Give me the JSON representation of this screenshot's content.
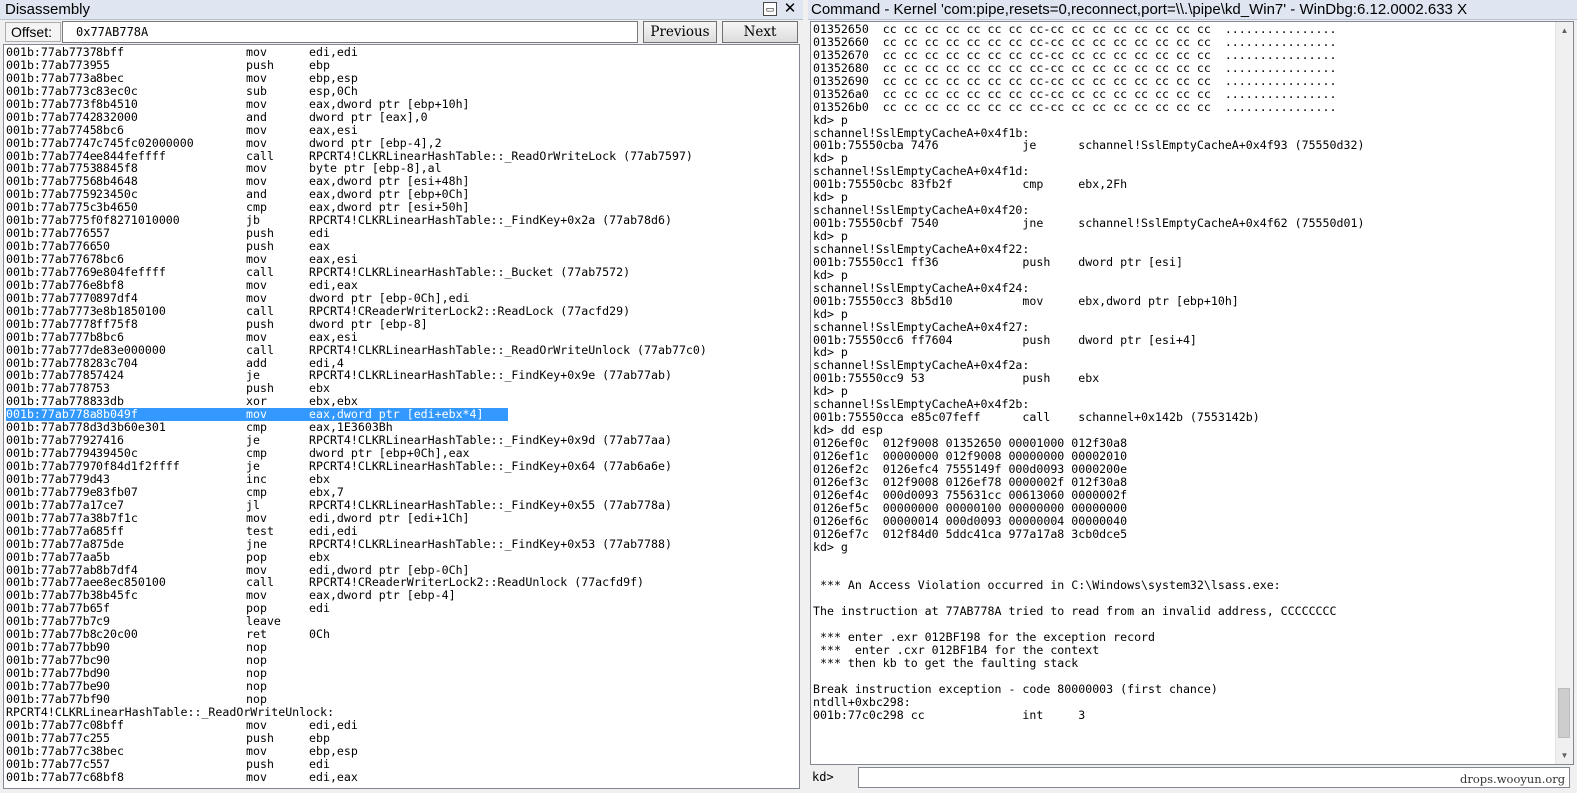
{
  "disassembly": {
    "title": "Disassembly",
    "restore_glyph": "▭",
    "close_glyph": "✕",
    "offset_label": "Offset:",
    "offset_value": "0x77AB778A",
    "previous_label": "Previous",
    "next_label": "Next",
    "lines": [
      {
        "addr": "001b:77ab7737",
        "bytes": "8bff",
        "mn": "mov",
        "op": "edi,edi"
      },
      {
        "addr": "001b:77ab7739",
        "bytes": "55",
        "mn": "push",
        "op": "ebp"
      },
      {
        "addr": "001b:77ab773a",
        "bytes": "8bec",
        "mn": "mov",
        "op": "ebp,esp"
      },
      {
        "addr": "001b:77ab773c",
        "bytes": "83ec0c",
        "mn": "sub",
        "op": "esp,0Ch"
      },
      {
        "addr": "001b:77ab773f",
        "bytes": "8b4510",
        "mn": "mov",
        "op": "eax,dword ptr [ebp+10h]"
      },
      {
        "addr": "001b:77ab7742",
        "bytes": "832000",
        "mn": "and",
        "op": "dword ptr [eax],0"
      },
      {
        "addr": "001b:77ab7745",
        "bytes": "8bc6",
        "mn": "mov",
        "op": "eax,esi"
      },
      {
        "addr": "001b:77ab7747",
        "bytes": "c745fc02000000",
        "mn": "mov",
        "op": "dword ptr [ebp-4],2"
      },
      {
        "addr": "001b:77ab774e",
        "bytes": "e844feffff",
        "mn": "call",
        "op": "RPCRT4!CLKRLinearHashTable::_ReadOrWriteLock (77ab7597)"
      },
      {
        "addr": "001b:77ab7753",
        "bytes": "8845f8",
        "mn": "mov",
        "op": "byte ptr [ebp-8],al"
      },
      {
        "addr": "001b:77ab7756",
        "bytes": "8b4648",
        "mn": "mov",
        "op": "eax,dword ptr [esi+48h]"
      },
      {
        "addr": "001b:77ab7759",
        "bytes": "23450c",
        "mn": "and",
        "op": "eax,dword ptr [ebp+0Ch]"
      },
      {
        "addr": "001b:77ab775c",
        "bytes": "3b4650",
        "mn": "cmp",
        "op": "eax,dword ptr [esi+50h]"
      },
      {
        "addr": "001b:77ab775f",
        "bytes": "0f8271010000",
        "mn": "jb",
        "op": "RPCRT4!CLKRLinearHashTable::_FindKey+0x2a (77ab78d6)"
      },
      {
        "addr": "001b:77ab7765",
        "bytes": "57",
        "mn": "push",
        "op": "edi"
      },
      {
        "addr": "001b:77ab7766",
        "bytes": "50",
        "mn": "push",
        "op": "eax"
      },
      {
        "addr": "001b:77ab7767",
        "bytes": "8bc6",
        "mn": "mov",
        "op": "eax,esi"
      },
      {
        "addr": "001b:77ab7769",
        "bytes": "e804feffff",
        "mn": "call",
        "op": "RPCRT4!CLKRLinearHashTable::_Bucket (77ab7572)"
      },
      {
        "addr": "001b:77ab776e",
        "bytes": "8bf8",
        "mn": "mov",
        "op": "edi,eax"
      },
      {
        "addr": "001b:77ab7770",
        "bytes": "897df4",
        "mn": "mov",
        "op": "dword ptr [ebp-0Ch],edi"
      },
      {
        "addr": "001b:77ab7773",
        "bytes": "e8b1850100",
        "mn": "call",
        "op": "RPCRT4!CReaderWriterLock2::ReadLock (77acfd29)"
      },
      {
        "addr": "001b:77ab7778",
        "bytes": "ff75f8",
        "mn": "push",
        "op": "dword ptr [ebp-8]"
      },
      {
        "addr": "001b:77ab777b",
        "bytes": "8bc6",
        "mn": "mov",
        "op": "eax,esi"
      },
      {
        "addr": "001b:77ab777d",
        "bytes": "e83e000000",
        "mn": "call",
        "op": "RPCRT4!CLKRLinearHashTable::_ReadOrWriteUnlock (77ab77c0)"
      },
      {
        "addr": "001b:77ab7782",
        "bytes": "83c704",
        "mn": "add",
        "op": "edi,4"
      },
      {
        "addr": "001b:77ab7785",
        "bytes": "7424",
        "mn": "je",
        "op": "RPCRT4!CLKRLinearHashTable::_FindKey+0x9e (77ab77ab)"
      },
      {
        "addr": "001b:77ab7787",
        "bytes": "53",
        "mn": "push",
        "op": "ebx"
      },
      {
        "addr": "001b:77ab7788",
        "bytes": "33db",
        "mn": "xor",
        "op": "ebx,ebx"
      },
      {
        "addr": "001b:77ab778a",
        "bytes": "8b049f",
        "mn": "mov",
        "op": "eax,dword ptr [edi+ebx*4]",
        "selected": true
      },
      {
        "addr": "001b:77ab778d",
        "bytes": "3d3b60e301",
        "mn": "cmp",
        "op": "eax,1E3603Bh"
      },
      {
        "addr": "001b:77ab7792",
        "bytes": "7416",
        "mn": "je",
        "op": "RPCRT4!CLKRLinearHashTable::_FindKey+0x9d (77ab77aa)"
      },
      {
        "addr": "001b:77ab7794",
        "bytes": "39450c",
        "mn": "cmp",
        "op": "dword ptr [ebp+0Ch],eax"
      },
      {
        "addr": "001b:77ab7797",
        "bytes": "0f84d1f2ffff",
        "mn": "je",
        "op": "RPCRT4!CLKRLinearHashTable::_FindKey+0x64 (77ab6a6e)"
      },
      {
        "addr": "001b:77ab779d",
        "bytes": "43",
        "mn": "inc",
        "op": "ebx"
      },
      {
        "addr": "001b:77ab779e",
        "bytes": "83fb07",
        "mn": "cmp",
        "op": "ebx,7"
      },
      {
        "addr": "001b:77ab77a1",
        "bytes": "7ce7",
        "mn": "jl",
        "op": "RPCRT4!CLKRLinearHashTable::_FindKey+0x55 (77ab778a)"
      },
      {
        "addr": "001b:77ab77a3",
        "bytes": "8b7f1c",
        "mn": "mov",
        "op": "edi,dword ptr [edi+1Ch]"
      },
      {
        "addr": "001b:77ab77a6",
        "bytes": "85ff",
        "mn": "test",
        "op": "edi,edi"
      },
      {
        "addr": "001b:77ab77a8",
        "bytes": "75de",
        "mn": "jne",
        "op": "RPCRT4!CLKRLinearHashTable::_FindKey+0x53 (77ab7788)"
      },
      {
        "addr": "001b:77ab77aa",
        "bytes": "5b",
        "mn": "pop",
        "op": "ebx"
      },
      {
        "addr": "001b:77ab77ab",
        "bytes": "8b7df4",
        "mn": "mov",
        "op": "edi,dword ptr [ebp-0Ch]"
      },
      {
        "addr": "001b:77ab77ae",
        "bytes": "e8ec850100",
        "mn": "call",
        "op": "RPCRT4!CReaderWriterLock2::ReadUnlock (77acfd9f)"
      },
      {
        "addr": "001b:77ab77b3",
        "bytes": "8b45fc",
        "mn": "mov",
        "op": "eax,dword ptr [ebp-4]"
      },
      {
        "addr": "001b:77ab77b6",
        "bytes": "5f",
        "mn": "pop",
        "op": "edi"
      },
      {
        "addr": "001b:77ab77b7",
        "bytes": "c9",
        "mn": "leave",
        "op": ""
      },
      {
        "addr": "001b:77ab77b8",
        "bytes": "c20c00",
        "mn": "ret",
        "op": "0Ch"
      },
      {
        "addr": "001b:77ab77bb",
        "bytes": "90",
        "mn": "nop",
        "op": ""
      },
      {
        "addr": "001b:77ab77bc",
        "bytes": "90",
        "mn": "nop",
        "op": ""
      },
      {
        "addr": "001b:77ab77bd",
        "bytes": "90",
        "mn": "nop",
        "op": ""
      },
      {
        "addr": "001b:77ab77be",
        "bytes": "90",
        "mn": "nop",
        "op": ""
      },
      {
        "addr": "001b:77ab77bf",
        "bytes": "90",
        "mn": "nop",
        "op": ""
      },
      {
        "label": "RPCRT4!CLKRLinearHashTable::_ReadOrWriteUnlock:"
      },
      {
        "addr": "001b:77ab77c0",
        "bytes": "8bff",
        "mn": "mov",
        "op": "edi,edi"
      },
      {
        "addr": "001b:77ab77c2",
        "bytes": "55",
        "mn": "push",
        "op": "ebp"
      },
      {
        "addr": "001b:77ab77c3",
        "bytes": "8bec",
        "mn": "mov",
        "op": "ebp,esp"
      },
      {
        "addr": "001b:77ab77c5",
        "bytes": "57",
        "mn": "push",
        "op": "edi"
      },
      {
        "addr": "001b:77ab77c6",
        "bytes": "8bf8",
        "mn": "mov",
        "op": "edi,eax"
      }
    ]
  },
  "command": {
    "title": "Command - Kernel 'com:pipe,resets=0,reconnect,port=\\\\.\\pipe\\kd_Win7' - WinDbg:6.12.0002.633 X",
    "prompt_label": "kd>",
    "input_value": "",
    "scroll_up_glyph": "▲",
    "scroll_down_glyph": "▼",
    "lines": [
      "01352650  cc cc cc cc cc cc cc cc-cc cc cc cc cc cc cc cc  ................",
      "01352660  cc cc cc cc cc cc cc cc-cc cc cc cc cc cc cc cc  ................",
      "01352670  cc cc cc cc cc cc cc cc-cc cc cc cc cc cc cc cc  ................",
      "01352680  cc cc cc cc cc cc cc cc-cc cc cc cc cc cc cc cc  ................",
      "01352690  cc cc cc cc cc cc cc cc-cc cc cc cc cc cc cc cc  ................",
      "013526a0  cc cc cc cc cc cc cc cc-cc cc cc cc cc cc cc cc  ................",
      "013526b0  cc cc cc cc cc cc cc cc-cc cc cc cc cc cc cc cc  ................",
      "kd> p",
      "schannel!SslEmptyCacheA+0x4f1b:",
      "001b:75550cba 7476            je      schannel!SslEmptyCacheA+0x4f93 (75550d32)",
      "kd> p",
      "schannel!SslEmptyCacheA+0x4f1d:",
      "001b:75550cbc 83fb2f          cmp     ebx,2Fh",
      "kd> p",
      "schannel!SslEmptyCacheA+0x4f20:",
      "001b:75550cbf 7540            jne     schannel!SslEmptyCacheA+0x4f62 (75550d01)",
      "kd> p",
      "schannel!SslEmptyCacheA+0x4f22:",
      "001b:75550cc1 ff36            push    dword ptr [esi]",
      "kd> p",
      "schannel!SslEmptyCacheA+0x4f24:",
      "001b:75550cc3 8b5d10          mov     ebx,dword ptr [ebp+10h]",
      "kd> p",
      "schannel!SslEmptyCacheA+0x4f27:",
      "001b:75550cc6 ff7604          push    dword ptr [esi+4]",
      "kd> p",
      "schannel!SslEmptyCacheA+0x4f2a:",
      "001b:75550cc9 53              push    ebx",
      "kd> p",
      "schannel!SslEmptyCacheA+0x4f2b:",
      "001b:75550cca e85c07feff      call    schannel+0x142b (7553142b)",
      "kd> dd esp",
      "0126ef0c  012f9008 01352650 00001000 012f30a8",
      "0126ef1c  00000000 012f9008 00000000 00002010",
      "0126ef2c  0126efc4 7555149f 000d0093 0000200e",
      "0126ef3c  012f9008 0126ef78 0000002f 012f30a8",
      "0126ef4c  000d0093 755631cc 00613060 0000002f",
      "0126ef5c  00000000 00000100 00000000 00000000",
      "0126ef6c  00000014 000d0093 00000004 00000040",
      "0126ef7c  012f84d0 5ddc41ca 977a17a8 3cb0dce5",
      "kd> g",
      "",
      "",
      " *** An Access Violation occurred in C:\\Windows\\system32\\lsass.exe:",
      "",
      "The instruction at 77AB778A tried to read from an invalid address, CCCCCCCC",
      "",
      " *** enter .exr 012BF198 for the exception record",
      " ***  enter .cxr 012BF1B4 for the context",
      " *** then kb to get the faulting stack",
      "",
      "Break instruction exception - code 80000003 (first chance)",
      "ntdll+0xbc298:",
      "001b:77c0c298 cc              int     3"
    ]
  },
  "watermark": "drops.wooyun.org"
}
